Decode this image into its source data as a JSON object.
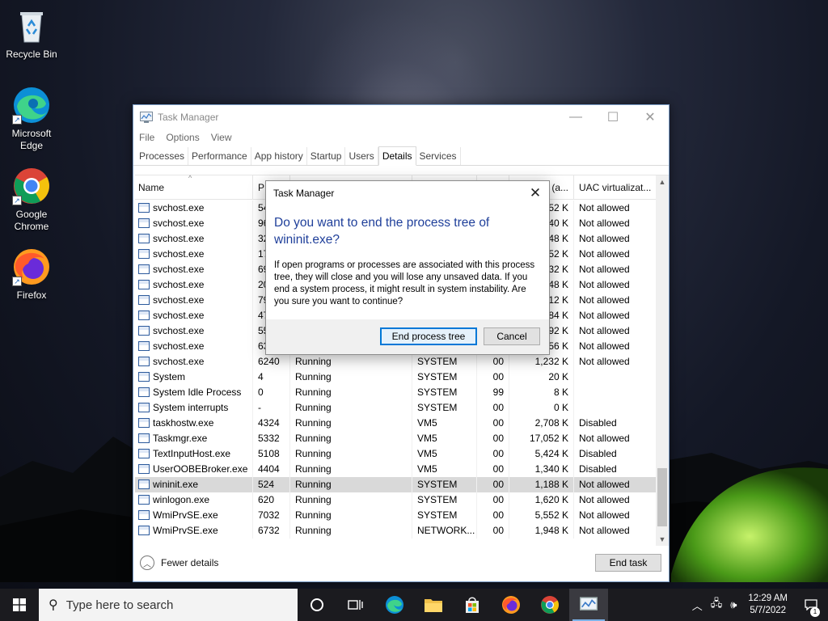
{
  "desktop": {
    "icons": [
      {
        "label": "Recycle Bin",
        "icon": "recycle-bin-icon"
      },
      {
        "label": "Microsoft Edge",
        "icon": "edge-icon"
      },
      {
        "label": "Google Chrome",
        "icon": "chrome-icon"
      },
      {
        "label": "Firefox",
        "icon": "firefox-icon"
      }
    ]
  },
  "window": {
    "title": "Task Manager",
    "menu": [
      "File",
      "Options",
      "View"
    ],
    "tabs": [
      "Processes",
      "Performance",
      "App history",
      "Startup",
      "Users",
      "Details",
      "Services"
    ],
    "active_tab": "Details",
    "columns": [
      "Name",
      "PI",
      "",
      "",
      "",
      "y (a...",
      "UAC virtualizat..."
    ],
    "rows": [
      {
        "name": "svchost.exe",
        "pid": "54",
        "status": "",
        "user": "",
        "cpu": "",
        "mem": "52 K",
        "uac": "Not allowed"
      },
      {
        "name": "svchost.exe",
        "pid": "96",
        "status": "",
        "user": "",
        "cpu": "",
        "mem": "40 K",
        "uac": "Not allowed"
      },
      {
        "name": "svchost.exe",
        "pid": "32",
        "status": "",
        "user": "",
        "cpu": "",
        "mem": "48 K",
        "uac": "Not allowed"
      },
      {
        "name": "svchost.exe",
        "pid": "17",
        "status": "",
        "user": "",
        "cpu": "",
        "mem": "52 K",
        "uac": "Not allowed"
      },
      {
        "name": "svchost.exe",
        "pid": "69",
        "status": "",
        "user": "",
        "cpu": "",
        "mem": "32 K",
        "uac": "Not allowed"
      },
      {
        "name": "svchost.exe",
        "pid": "20",
        "status": "",
        "user": "",
        "cpu": "",
        "mem": "48 K",
        "uac": "Not allowed"
      },
      {
        "name": "svchost.exe",
        "pid": "79",
        "status": "",
        "user": "",
        "cpu": "",
        "mem": "12 K",
        "uac": "Not allowed"
      },
      {
        "name": "svchost.exe",
        "pid": "47",
        "status": "",
        "user": "",
        "cpu": "",
        "mem": "84 K",
        "uac": "Not allowed"
      },
      {
        "name": "svchost.exe",
        "pid": "55",
        "status": "",
        "user": "",
        "cpu": "",
        "mem": "92 K",
        "uac": "Not allowed"
      },
      {
        "name": "svchost.exe",
        "pid": "63",
        "status": "",
        "user": "",
        "cpu": "",
        "mem": "56 K",
        "uac": "Not allowed"
      },
      {
        "name": "svchost.exe",
        "pid": "6240",
        "status": "Running",
        "user": "SYSTEM",
        "cpu": "00",
        "mem": "1,232 K",
        "uac": "Not allowed"
      },
      {
        "name": "System",
        "pid": "4",
        "status": "Running",
        "user": "SYSTEM",
        "cpu": "00",
        "mem": "20 K",
        "uac": ""
      },
      {
        "name": "System Idle Process",
        "pid": "0",
        "status": "Running",
        "user": "SYSTEM",
        "cpu": "99",
        "mem": "8 K",
        "uac": ""
      },
      {
        "name": "System interrupts",
        "pid": "-",
        "status": "Running",
        "user": "SYSTEM",
        "cpu": "00",
        "mem": "0 K",
        "uac": ""
      },
      {
        "name": "taskhostw.exe",
        "pid": "4324",
        "status": "Running",
        "user": "VM5",
        "cpu": "00",
        "mem": "2,708 K",
        "uac": "Disabled"
      },
      {
        "name": "Taskmgr.exe",
        "pid": "5332",
        "status": "Running",
        "user": "VM5",
        "cpu": "00",
        "mem": "17,052 K",
        "uac": "Not allowed"
      },
      {
        "name": "TextInputHost.exe",
        "pid": "5108",
        "status": "Running",
        "user": "VM5",
        "cpu": "00",
        "mem": "5,424 K",
        "uac": "Disabled"
      },
      {
        "name": "UserOOBEBroker.exe",
        "pid": "4404",
        "status": "Running",
        "user": "VM5",
        "cpu": "00",
        "mem": "1,340 K",
        "uac": "Disabled"
      },
      {
        "name": "wininit.exe",
        "pid": "524",
        "status": "Running",
        "user": "SYSTEM",
        "cpu": "00",
        "mem": "1,188 K",
        "uac": "Not allowed",
        "selected": true
      },
      {
        "name": "winlogon.exe",
        "pid": "620",
        "status": "Running",
        "user": "SYSTEM",
        "cpu": "00",
        "mem": "1,620 K",
        "uac": "Not allowed"
      },
      {
        "name": "WmiPrvSE.exe",
        "pid": "7032",
        "status": "Running",
        "user": "SYSTEM",
        "cpu": "00",
        "mem": "5,552 K",
        "uac": "Not allowed"
      },
      {
        "name": "WmiPrvSE.exe",
        "pid": "6732",
        "status": "Running",
        "user": "NETWORK...",
        "cpu": "00",
        "mem": "1,948 K",
        "uac": "Not allowed"
      }
    ],
    "fewer_details": "Fewer details",
    "end_task": "End task"
  },
  "dialog": {
    "title": "Task Manager",
    "heading": "Do you want to end the process tree of wininit.exe?",
    "body": "If open programs or processes are associated with this process tree, they will close and you will lose any unsaved data. If you end a system process, it might result in system instability. Are you sure you want to continue?",
    "primary_button": "End process tree",
    "cancel_button": "Cancel"
  },
  "taskbar": {
    "search_placeholder": "Type here to search",
    "time": "12:29 AM",
    "date": "5/7/2022",
    "notification_count": "1",
    "pinned": [
      "cortana-icon",
      "task-view-icon",
      "edge-icon",
      "file-explorer-icon",
      "store-icon",
      "firefox-icon",
      "chrome-icon",
      "task-manager-icon"
    ]
  }
}
